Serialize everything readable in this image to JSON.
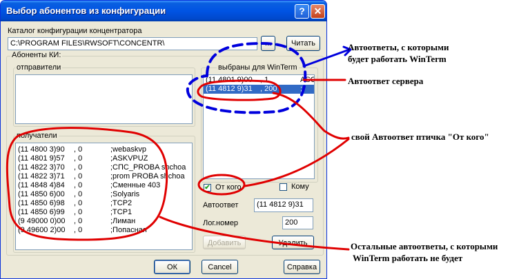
{
  "window": {
    "title": "Выбор абонентов из конфигурации",
    "help_label": "?",
    "close_label": "✕"
  },
  "catalog": {
    "label": "Каталог конфигурации концентратора",
    "path": "C:\\PROGRAM FILES\\RWSOFT\\CONCENTR\\",
    "browse_label": "...",
    "read_label": "Читать"
  },
  "subscribers": {
    "group_label": "Абоненты  КИ:",
    "senders_label": "отправители",
    "recipients_label": "получатели",
    "recipients": [
      {
        "addr": "(11 4800 3)90",
        "n": ", 0",
        "name": ";webaskvp"
      },
      {
        "addr": "(11 4801 9)57",
        "n": ", 0",
        "name": ";ASKVPUZ"
      },
      {
        "addr": "(11 4822 3)70",
        "n": ", 0",
        "name": ";СПС_PROBA shchoa"
      },
      {
        "addr": "(11 4822 3)71",
        "n": ", 0",
        "name": ";prom PROBA shchoa"
      },
      {
        "addr": "(11 4848 4)84",
        "n": ", 0",
        "name": ";Сменные 403"
      },
      {
        "addr": "(11 4850 6)00",
        "n": ", 0",
        "name": ";Solyaris"
      },
      {
        "addr": "(11 4850 6)98",
        "n": ", 0",
        "name": ";TCP2"
      },
      {
        "addr": "(11 4850 6)99",
        "n": ", 0",
        "name": ";TCP1"
      },
      {
        "addr": "(9 49000 0)00",
        "n": ", 0",
        "name": ";Лиман"
      },
      {
        "addr": "(9 49600 2)00",
        "n": ", 0",
        "name": ";Попасная"
      }
    ]
  },
  "selected": {
    "label": "выбраны  для   WinTerm",
    "rows": [
      {
        "addr": "(11 4801 9)00",
        "n": ", 1",
        "name": "ASOUP"
      },
      {
        "addr": "(11 4812 9)31",
        "n": ", 200",
        "name": ";"
      }
    ]
  },
  "form": {
    "from_label": "От кого",
    "from_checked": "✔",
    "to_label": "Кому",
    "autoanswer_label": "Автоответ",
    "autoanswer_value": "(11 4812 9)31",
    "lognum_label": "Лог.номер",
    "lognum_value": "200",
    "add_label": "Добавить",
    "delete_label": "Удалить"
  },
  "footer": {
    "ok_label": "ОК",
    "cancel_label": "Cancel",
    "help_label": "Справка"
  },
  "annotations": {
    "a1_line1": "Автоответы, с которыми",
    "a1_line2": "будет работать WinTerm",
    "a2": "Автоответ сервера",
    "a3": "свой Автоответ птичка \"От кого\"",
    "a4_line1": "Остальные автоответы, с которыми",
    "a4_line2": "WinTerm работать не будет"
  },
  "colors": {
    "red_marker": "#e00000",
    "blue_marker": "#0000dd",
    "selection": "#316ac5"
  }
}
